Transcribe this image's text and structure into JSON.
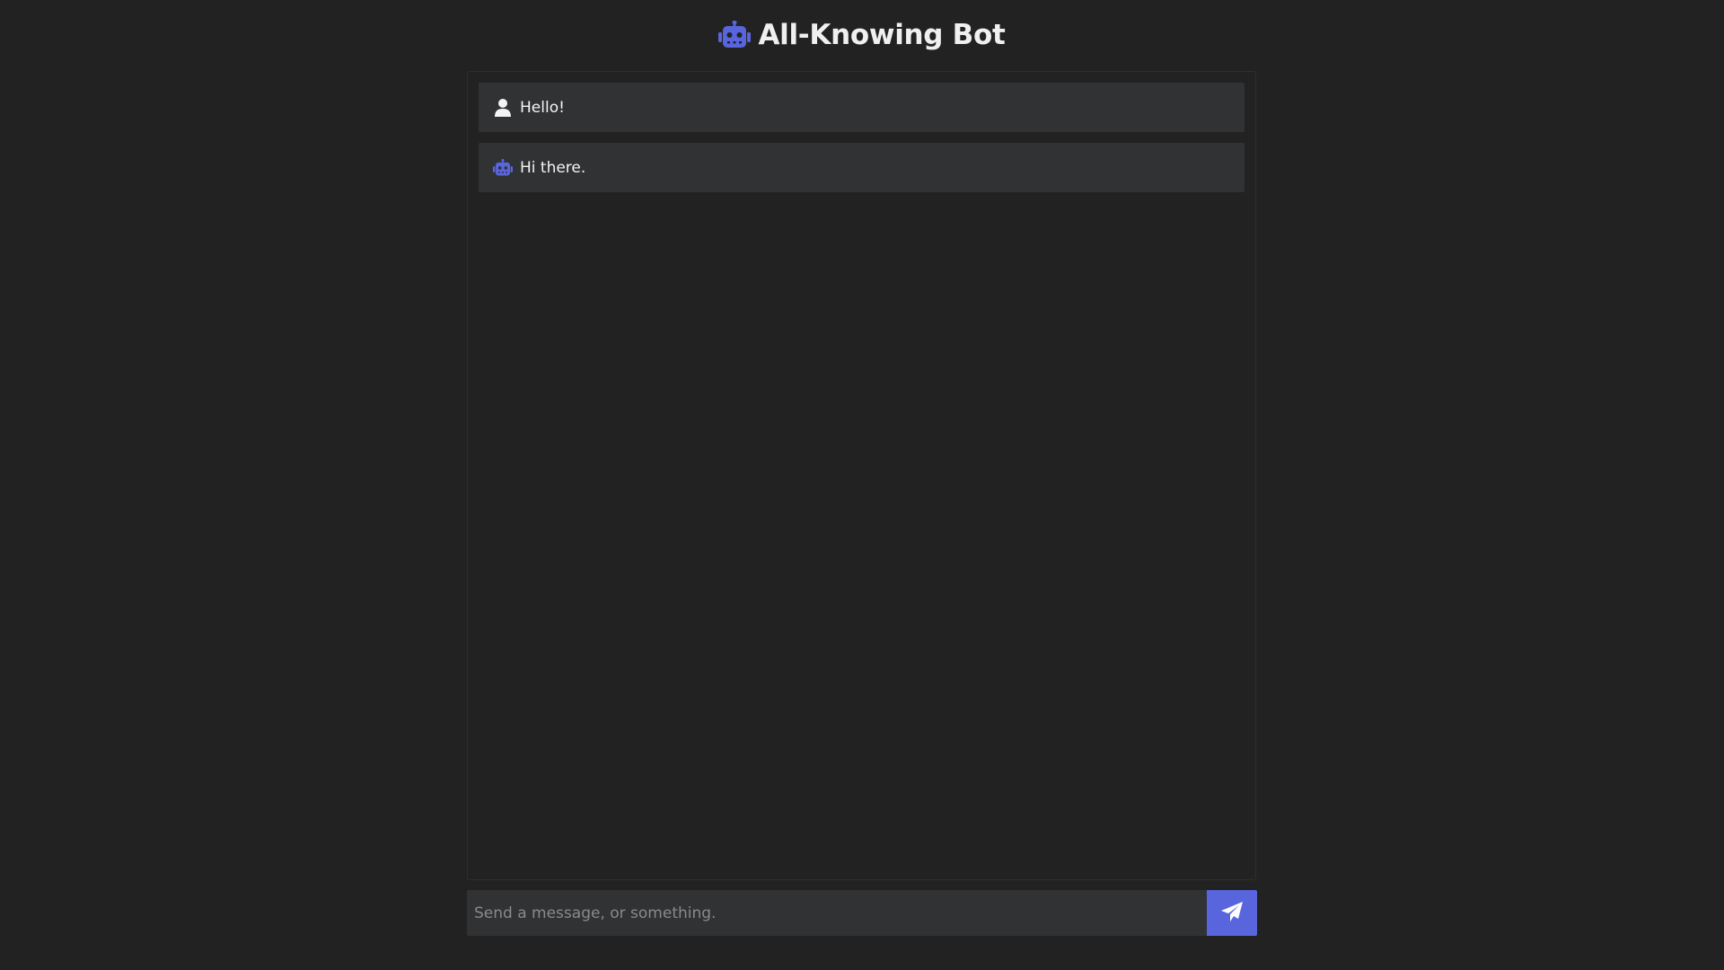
{
  "header": {
    "title": "All-Knowing Bot",
    "logo_icon": "robot-icon"
  },
  "messages": [
    {
      "role": "user",
      "icon": "user-icon",
      "text": "Hello!"
    },
    {
      "role": "bot",
      "icon": "robot-icon",
      "text": "Hi there."
    }
  ],
  "composer": {
    "placeholder": "Send a message, or something.",
    "value": "",
    "send_icon": "paper-plane-icon"
  },
  "colors": {
    "background": "#222222",
    "panel_border": "#2e2e2e",
    "message_bg": "#313234",
    "accent": "#5865dd",
    "text": "#f4f4f4"
  }
}
